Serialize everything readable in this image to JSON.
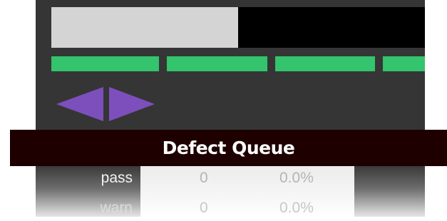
{
  "title": "Defect Queue",
  "progress": {
    "fraction": 0.5
  },
  "segments": {
    "count": 4,
    "color": "#33c46d"
  },
  "nav": {
    "prev_icon": "triangle-left-icon",
    "next_icon": "triangle-right-icon",
    "color": "#7d4fbc"
  },
  "stats": [
    {
      "label": "pass",
      "count": "0",
      "percent": "0.0%"
    },
    {
      "label": "warn",
      "count": "0",
      "percent": "0.0%"
    }
  ]
}
